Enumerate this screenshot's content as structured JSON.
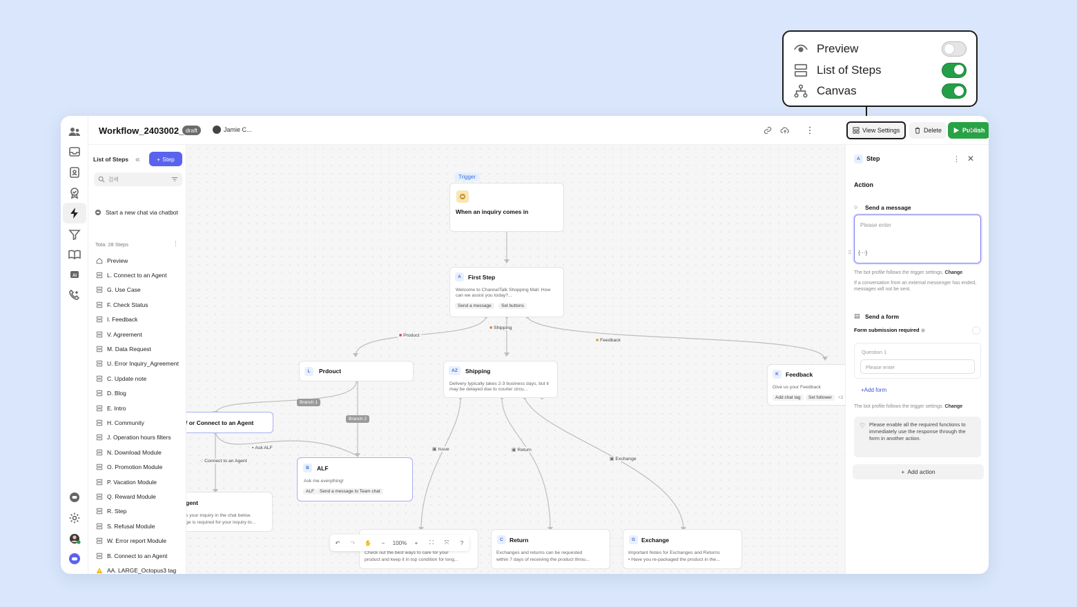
{
  "view_settings_popup": {
    "items": [
      {
        "label": "Preview",
        "icon": "eye-icon",
        "enabled": false
      },
      {
        "label": "List of Steps",
        "icon": "rows-icon",
        "enabled": true
      },
      {
        "label": "Canvas",
        "icon": "hierarchy-icon",
        "enabled": true
      }
    ]
  },
  "header": {
    "title": "Workflow_2403002_1",
    "status_badge": "draft",
    "owner": "Jamie C...",
    "view_settings_label": "View Settings",
    "delete_label": "Delete",
    "publish_label": "Publish"
  },
  "list_panel": {
    "title": "List of Steps",
    "add_step_label": "Step",
    "search_placeholder": "검색",
    "starter": "Start a new chat via chatbot",
    "count_label": "Tota: 28 Steps",
    "items": [
      "Preview",
      "L. Connect to an Agent",
      "G. Use Case",
      "F. Check Status",
      "I. Feedback",
      "V. Agreement",
      "M. Data Request",
      "U. Error Inquiry_Agreement",
      "C. Update note",
      "D. Blog",
      "E. Intro",
      "H. Community",
      "J. Operation hours filters",
      "N. Download Module",
      "O. Promotion Module",
      "P. Vacation Module",
      "Q. Reward Module",
      "R. Step",
      "S. Refusal Module",
      "W. Error report Module",
      "B. Connect to an Agent",
      "AA. LARGE_Octopus3 tag"
    ]
  },
  "canvas": {
    "trigger_tag": "Trigger",
    "trigger_title": "When an inquiry comes in",
    "first_step": {
      "badge": "A",
      "title": "First Step",
      "text": "Welcome to ChannelTalk Shopping Mall. How can we assist you today?...",
      "chips": [
        "Send a message",
        "Set buttons"
      ]
    },
    "edges": {
      "product": "Product",
      "shipping": "Shipping",
      "feedback": "Feedback",
      "branch1": "Branch 1",
      "branch2": "Branch 2",
      "ask_alf": "Ask ALF",
      "connect_agent": "Connect to an Agent",
      "issue": "Issue",
      "return": "Return",
      "exchange": "Exchange"
    },
    "prdouct": {
      "badge": "L",
      "title": "Prdouct"
    },
    "shipping": {
      "badge": "AZ",
      "title": "Shipping",
      "text": "Delivery typically takes 2-3 business days, but it may be delayed due to courier circu..."
    },
    "feedback": {
      "badge": "K",
      "title": "Feedback",
      "text": "Give us your Feedback",
      "chips": [
        "Add chat tag",
        "Set follower",
        "+2"
      ]
    },
    "connect_node": {
      "title": "/ or Connect to an Agent"
    },
    "agent_node": {
      "title": "gent",
      "text1": "s your inquiry in the chat below.",
      "text2": "ge is required for your inquiry to..."
    },
    "alf": {
      "badge": "B",
      "title": "ALF",
      "text": "Ask me everything!",
      "chips": [
        "ALF",
        "Send a message to Team chat"
      ]
    },
    "issue_node": {
      "text1": "Check out the best ways to care for your",
      "text2": "product and keep it in top condition for long..."
    },
    "return_node": {
      "badge": "C",
      "title": "Return",
      "text1": "Exchanges and returns can be requested",
      "text2": "within 7 days of receiving the product throu..."
    },
    "exchange_node": {
      "badge": "G",
      "title": "Exchange",
      "text1": "Important Notes for Exchanges and Returns",
      "text2": "• Have you re-packaged the product in the..."
    },
    "zoom": "100%"
  },
  "step_panel": {
    "badge": "A",
    "title": "Step",
    "section": "Action",
    "send_message_label": "Send a message",
    "message_placeholder": "Please enter",
    "variable_token": "{···}",
    "note1": "The bot profile follows the trigger settings.",
    "change_label": "Change",
    "note2": "If a conversation from an external messenger has ended, messages will not be sent.",
    "send_form_label": "Send a form",
    "form_required_label": "Form submission required",
    "form_required": true,
    "question_label": "Question 1",
    "question_placeholder": "Please enter",
    "add_form_label": "Add form",
    "note3": "The bot profile follows the trigger settings.",
    "tip": "Please enable all the required functions to immediately use the response through the form in another action.",
    "add_action_label": "Add action"
  }
}
